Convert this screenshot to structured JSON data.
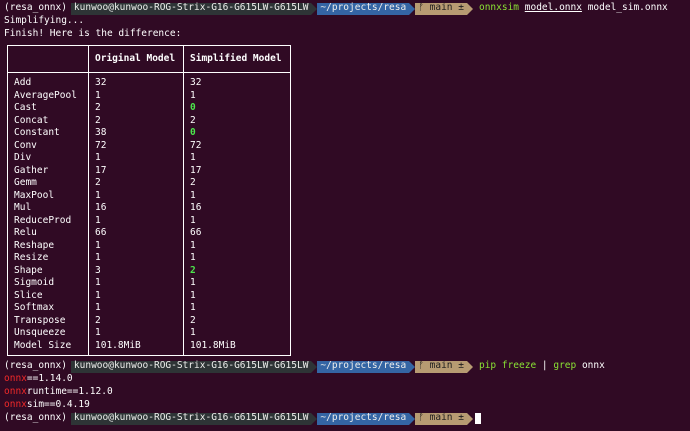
{
  "prompt": {
    "env": "(resa_onnx)",
    "user": "kunwoo@kunwoo-ROG-Strix-G16-G615LW-G615LW",
    "path": "~/projects/resa",
    "git": "ᚠ main ±"
  },
  "command1": {
    "prog": "onnxsim",
    "arg1": "model.onnx",
    "arg2": "model_sim.onnx"
  },
  "output": {
    "simplifying": "Simplifying...",
    "finish": "Finish! Here is the difference:"
  },
  "table": {
    "headers": [
      "",
      "Original Model",
      "Simplified Model"
    ],
    "rows": [
      {
        "op": "Add",
        "orig": "32",
        "sim": "32",
        "changed": false
      },
      {
        "op": "AveragePool",
        "orig": "1",
        "sim": "1",
        "changed": false
      },
      {
        "op": "Cast",
        "orig": "2",
        "sim": "0",
        "changed": true
      },
      {
        "op": "Concat",
        "orig": "2",
        "sim": "2",
        "changed": false
      },
      {
        "op": "Constant",
        "orig": "38",
        "sim": "0",
        "changed": true
      },
      {
        "op": "Conv",
        "orig": "72",
        "sim": "72",
        "changed": false
      },
      {
        "op": "Div",
        "orig": "1",
        "sim": "1",
        "changed": false
      },
      {
        "op": "Gather",
        "orig": "17",
        "sim": "17",
        "changed": false
      },
      {
        "op": "Gemm",
        "orig": "2",
        "sim": "2",
        "changed": false
      },
      {
        "op": "MaxPool",
        "orig": "1",
        "sim": "1",
        "changed": false
      },
      {
        "op": "Mul",
        "orig": "16",
        "sim": "16",
        "changed": false
      },
      {
        "op": "ReduceProd",
        "orig": "1",
        "sim": "1",
        "changed": false
      },
      {
        "op": "Relu",
        "orig": "66",
        "sim": "66",
        "changed": false
      },
      {
        "op": "Reshape",
        "orig": "1",
        "sim": "1",
        "changed": false
      },
      {
        "op": "Resize",
        "orig": "1",
        "sim": "1",
        "changed": false
      },
      {
        "op": "Shape",
        "orig": "3",
        "sim": "2",
        "changed": true
      },
      {
        "op": "Sigmoid",
        "orig": "1",
        "sim": "1",
        "changed": false
      },
      {
        "op": "Slice",
        "orig": "1",
        "sim": "1",
        "changed": false
      },
      {
        "op": "Softmax",
        "orig": "1",
        "sim": "1",
        "changed": false
      },
      {
        "op": "Transpose",
        "orig": "2",
        "sim": "2",
        "changed": false
      },
      {
        "op": "Unsqueeze",
        "orig": "1",
        "sim": "1",
        "changed": false
      },
      {
        "op": "Model Size",
        "orig": "101.8MiB",
        "sim": "101.8MiB",
        "changed": false
      }
    ]
  },
  "command2": {
    "pip": "pip freeze",
    "pipe": " | ",
    "grep": "grep",
    "arg": " onnx"
  },
  "freeze": [
    {
      "hl": "onnx",
      "rest": "==1.14.0"
    },
    {
      "hl": "onnx",
      "rest": "runtime==1.12.0"
    },
    {
      "hl": "onnx",
      "rest": "sim==0.4.19"
    }
  ],
  "colors": {
    "background": "#300a24",
    "path_segment": "#3465a4",
    "git_segment": "#b79b72",
    "highlight_green": "#4ce64c",
    "grep_red": "#ef2929"
  }
}
